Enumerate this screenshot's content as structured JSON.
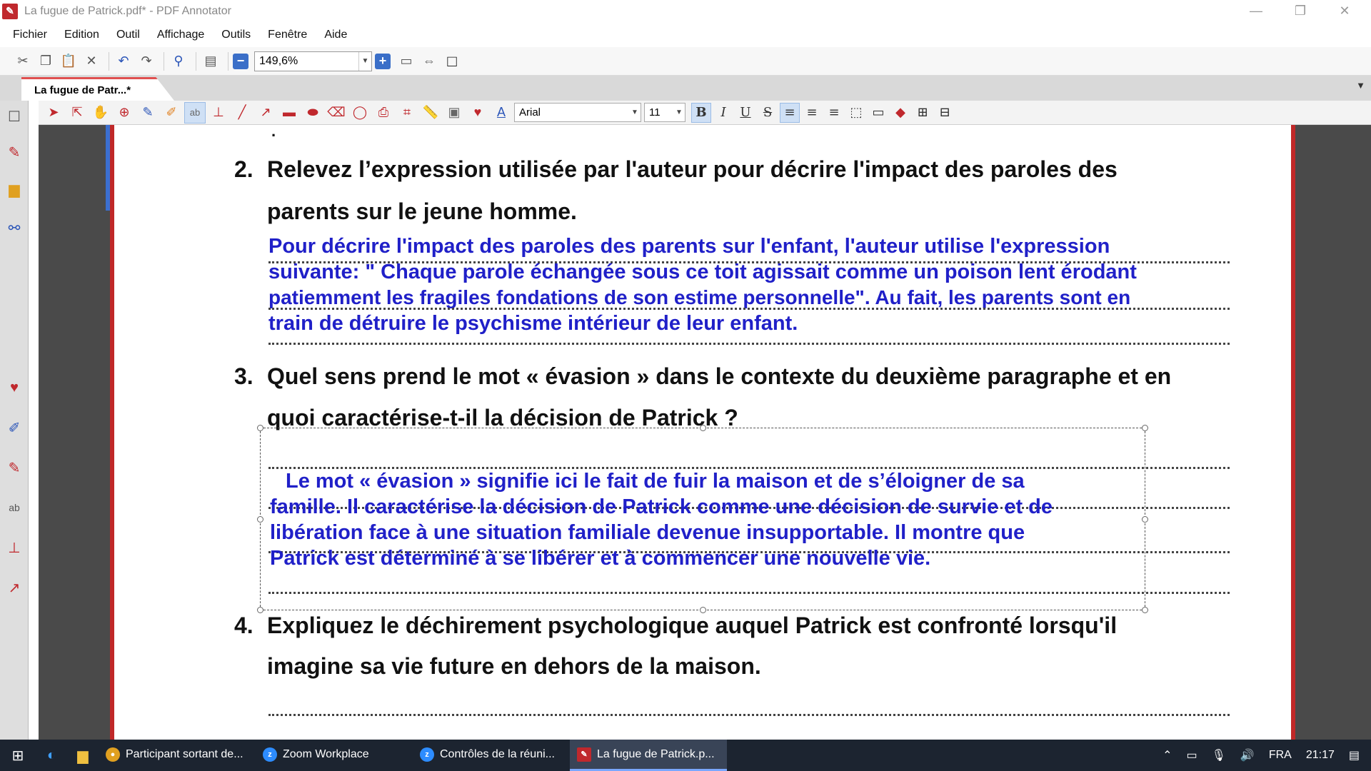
{
  "window": {
    "title": "La fugue de Patrick.pdf* - PDF Annotator",
    "app_icon": "pdf-annotator-icon",
    "minimize": "—",
    "restore": "❐",
    "close": "✕"
  },
  "menu": [
    "Fichier",
    "Edition",
    "Outil",
    "Affichage",
    "Outils",
    "Fenêtre",
    "Aide"
  ],
  "toolbar": {
    "zoom_value": "149,6%"
  },
  "tab": {
    "label": "La fugue de Patr...*"
  },
  "format": {
    "font_name": "Arial",
    "font_size": "11",
    "bold": "B",
    "italic": "I",
    "underline": "U",
    "strike": "S",
    "text_color": "A"
  },
  "document": {
    "top_mark": ".",
    "questions": [
      {
        "number": "2.",
        "line1": "Relevez l’expression utilisée par l'auteur pour décrire l'impact des paroles des",
        "line2": "parents sur le jeune homme."
      },
      {
        "number": "3.",
        "line1": "Quel sens prend le mot « évasion » dans le contexte du deuxième paragraphe et en",
        "line2": "quoi caractérise-t-il la décision de Patrick ?"
      },
      {
        "number": "4.",
        "line1": "Expliquez le déchirement psychologique auquel Patrick est confronté lorsqu'il",
        "line2": "imagine sa vie future en dehors de la maison."
      }
    ],
    "answer2": [
      "Pour décrire l'impact des paroles des parents sur l'enfant, l'auteur utilise l'expression",
      "suivante: \" Chaque parole échangée sous ce toit agissait comme un poison lent érodant",
      "patiemment les fragiles fondations de son estime personnelle\". Au fait, les parents sont en",
      "train de détruire le psychisme intérieur de leur enfant."
    ],
    "answer3": [
      "Le mot « évasion » signifie ici le fait de fuir la maison et de s’éloigner de sa",
      "famille. Il caractérise la décision de Patrick comme une décision de survie et de",
      "libération face à une situation familiale devenue insupportable.  Il montre que",
      "Patrick est déterminé à se libérer et à commencer une nouvelle vie."
    ]
  },
  "taskbar": {
    "items": [
      {
        "label": "Participant sortant de...",
        "icon": "chrome-icon",
        "color": "#e0a020"
      },
      {
        "label": "Zoom Workplace",
        "icon": "zoom-icon",
        "color": "#2d8cff"
      },
      {
        "label": "Contrôles de la réuni...",
        "icon": "zoom-icon",
        "color": "#2d8cff"
      },
      {
        "label": "La fugue de Patrick.p...",
        "icon": "pdf-annotator-icon",
        "color": "#c0282d"
      }
    ],
    "language": "FRA",
    "time": "21:17"
  },
  "colors": {
    "answer_blue": "#2020c8",
    "accent_red": "#c0282d",
    "taskbar": "#1c2430"
  }
}
